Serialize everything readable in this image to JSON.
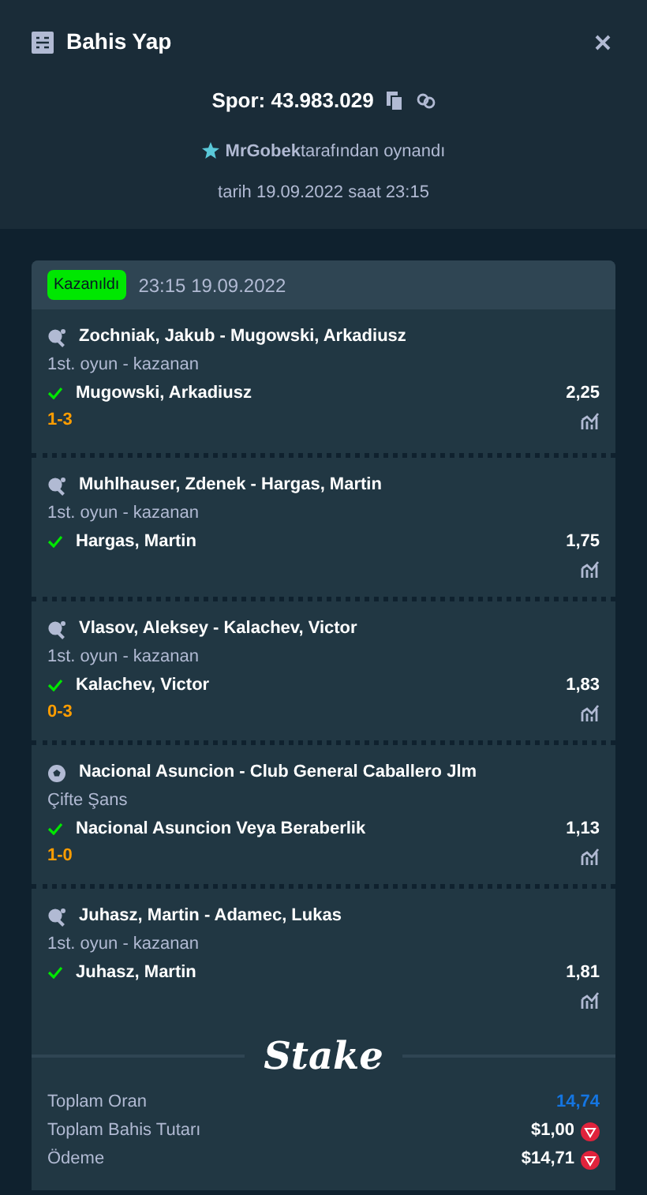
{
  "header": {
    "title": "Bahis Yap"
  },
  "bet": {
    "id": "Spor: 43.983.029",
    "user": "MrGobek",
    "played_by": "tarafından oynandı",
    "date": "tarih 19.09.2022 saat 23:15"
  },
  "slip": {
    "status": "Kazanıldı",
    "time": "23:15 19.09.2022",
    "legs": [
      {
        "kind": "table_tennis",
        "event": "Zochniak, Jakub - Mugowski, Arkadiusz",
        "market": "1st. oyun - kazanan",
        "selection": "Mugowski, Arkadiusz",
        "won": true,
        "odds": "2,25",
        "score": "1-3"
      },
      {
        "kind": "table_tennis",
        "event": "Muhlhauser, Zdenek - Hargas, Martin",
        "market": "1st. oyun - kazanan",
        "selection": "Hargas, Martin",
        "won": true,
        "odds": "1,75"
      },
      {
        "kind": "table_tennis",
        "event": "Vlasov, Aleksey - Kalachev, Victor",
        "market": "1st. oyun - kazanan",
        "selection": "Kalachev, Victor",
        "won": true,
        "odds": "1,83",
        "score": "0-3"
      },
      {
        "kind": "soccer",
        "event": "Nacional Asuncion - Club General Caballero Jlm",
        "market": "Çifte Şans",
        "selection": "Nacional Asuncion Veya Beraberlik",
        "won": true,
        "odds": "1,13",
        "score": "1-0"
      },
      {
        "kind": "table_tennis",
        "event": "Juhasz, Martin - Adamec, Lukas",
        "market": "1st. oyun - kazanan",
        "selection": "Juhasz, Martin",
        "won": true,
        "odds": "1,81"
      }
    ],
    "logo": "Stake",
    "totals": [
      {
        "label": "Toplam Oran",
        "value": "14,74",
        "kind": "odds"
      },
      {
        "label": "Toplam Bahis Tutarı",
        "value": "$1,00",
        "kind": "currency"
      },
      {
        "label": "Ödeme",
        "value": "$14,71",
        "kind": "currency"
      }
    ]
  }
}
